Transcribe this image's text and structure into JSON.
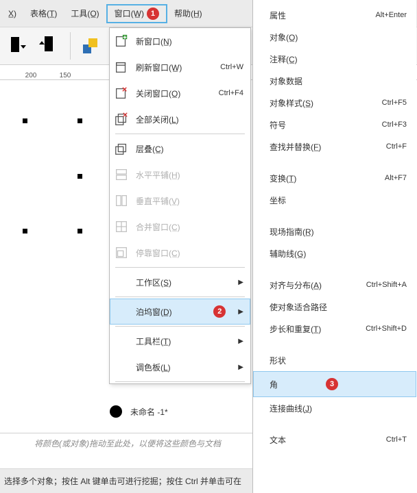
{
  "menubar": {
    "file": "X̲)",
    "table": "表格(T̲)",
    "tools": "工具(O̲)",
    "window": "窗口(W̲)",
    "help": "帮助(H̲)"
  },
  "ruler": {
    "t200": "200",
    "t150": "150"
  },
  "window_menu": {
    "new": "新窗口(N̲)",
    "refresh": "刷新窗口(W̲)",
    "refresh_sc": "Ctrl+W",
    "close": "关闭窗口(O̲)",
    "close_sc": "Ctrl+F4",
    "closeall": "全部关闭(L̲)",
    "cascade": "层叠(C̲)",
    "htile": "水平平铺(H̲)",
    "vtile": "垂直平铺(V̲)",
    "combine": "合并窗口(C̲)",
    "dock": "停靠窗口(C̲)",
    "workspace": "工作区(S̲)",
    "dockers": "泊坞窗(D̲)",
    "toolbars": "工具栏(T̲)",
    "palette": "调色板(L̲)",
    "untitled": "未命名 -1*"
  },
  "badges": {
    "one": "1",
    "two": "2",
    "three": "3"
  },
  "side": {
    "props": "属性",
    "props_sc": "Alt+Enter",
    "object": "对象(O̲)",
    "comment": "注释(C̲)",
    "objdata": "对象数据",
    "objstyle": "对象样式(S̲)",
    "objstyle_sc": "Ctrl+F5",
    "symbol": "符号",
    "symbol_sc": "Ctrl+F3",
    "find": "查找并替换(F̲)",
    "find_sc": "Ctrl+F",
    "transform": "变换(T̲)",
    "transform_sc": "Alt+F7",
    "coord": "坐标",
    "guide": "现场指南(R̲)",
    "aux": "辅助线(G̲)",
    "align": "对齐与分布(A̲)",
    "align_sc": "Ctrl+Shift+A",
    "fit": "使对象适合路径",
    "step": "步长和重复(T̲)",
    "step_sc": "Ctrl+Shift+D",
    "shape": "形状",
    "corner": "角",
    "curve": "连接曲线(J̲)",
    "text": "文本",
    "text_sc": "Ctrl+T"
  },
  "status": {
    "hint1": "将颜色(或对象)拖动至此处，以便将这些颜色与文档",
    "hint2": "选择多个对象；按住 Alt 键单击可进行挖掘；按住 Ctrl 并单击可在"
  }
}
